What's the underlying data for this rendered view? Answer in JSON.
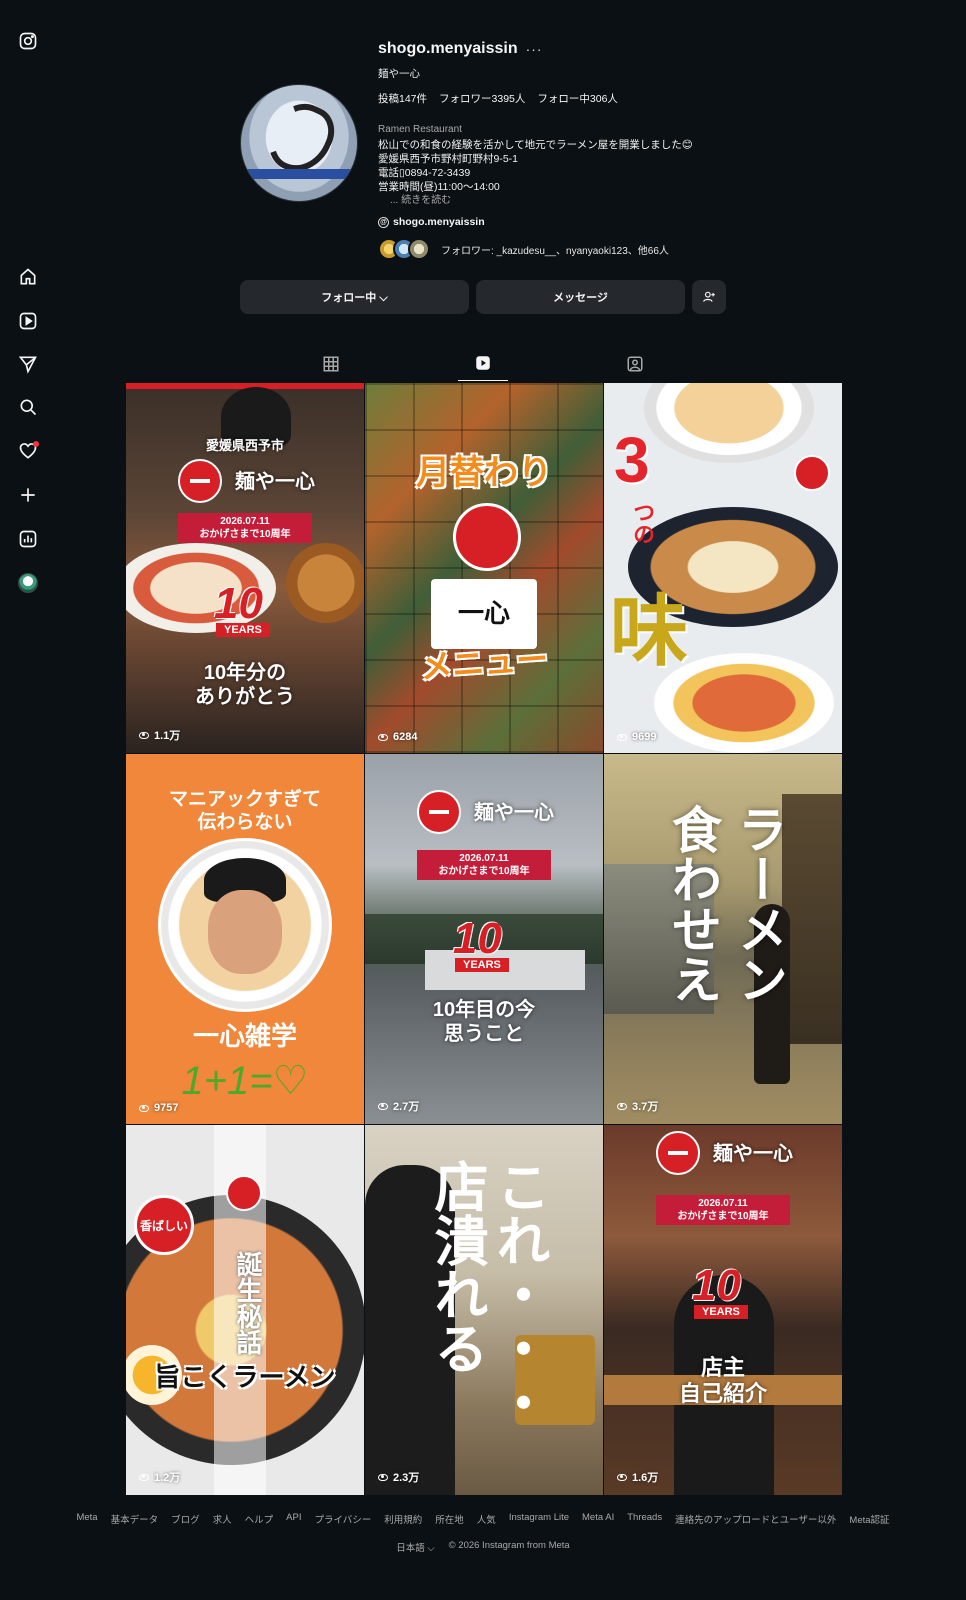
{
  "sidebar": {
    "icons": [
      "instagram-icon",
      "home-icon",
      "reels-icon",
      "direct-icon",
      "search-icon",
      "heart-icon",
      "create-icon",
      "insights-icon",
      "profile-icon"
    ]
  },
  "profile": {
    "username": "shogo.menyaissin",
    "more": "···",
    "fullname": "麺や一心",
    "stats": {
      "posts": "投稿147件",
      "followers": "フォロワー3395人",
      "following": "フォロー中306人"
    },
    "category": "Ramen Restaurant",
    "bio": [
      "松山での和食の経験を活かして地元でラーメン屋を開業しました😊",
      "愛媛県西予市野村町野村9-5-1",
      "電話▯0894-72-3439",
      "営業時間(昼)11:00〜14:00"
    ],
    "bio_more": "... 続きを読む",
    "threads_handle": "shogo.menyaissin",
    "followed_by": "フォロワー: _kazudesu__、nyanyaoki123、他66人"
  },
  "buttons": {
    "follow": "フォロー中 ⌵",
    "message": "メッセージ"
  },
  "tabs": [
    "posts-tab",
    "reels-tab",
    "tagged-tab"
  ],
  "reels": [
    {
      "views": "1.1万",
      "caption_top": "愛媛県西予市",
      "brand": "麺や一心",
      "date": "2026.07.11",
      "sub": "おかげさまで10周年",
      "ten": "10",
      "years": "YEARS",
      "caption": "10年分の\nありがとう"
    },
    {
      "views": "6284",
      "title": "月替わり",
      "caption": "メニュー"
    },
    {
      "views": "9699",
      "number": "3",
      "small": "つの",
      "big": "味"
    },
    {
      "views": "9757",
      "title": "マニアックすぎて\n伝わらない",
      "caption": "一心雑学",
      "scribble": "1+1=♡"
    },
    {
      "views": "2.7万",
      "brand": "麺や一心",
      "date": "2026.07.11",
      "sub": "おかげさまで10周年",
      "ten": "10",
      "years": "YEARS",
      "caption": "10年目の今\n思うこと"
    },
    {
      "views": "3.7万",
      "col1": "ラーメン",
      "col2": "食わせえ"
    },
    {
      "views": "1.2万",
      "vertical": "誕生秘話",
      "caption": "旨こくラーメン",
      "stamp": "香ばしい"
    },
    {
      "views": "2.3万",
      "col1": "これ・・・",
      "col2": "店潰れる"
    },
    {
      "views": "1.6万",
      "brand": "麺や一心",
      "date": "2026.07.11",
      "sub": "おかげさまで10周年",
      "ten": "10",
      "years": "YEARS",
      "caption": "店主\n自己紹介"
    }
  ],
  "footer": {
    "links": [
      "Meta",
      "基本データ",
      "ブログ",
      "求人",
      "ヘルプ",
      "API",
      "プライバシー",
      "利用規約",
      "所在地",
      "人気",
      "Instagram Lite",
      "Meta AI",
      "Threads",
      "連絡先のアップロードとユーザー以外",
      "Meta認証"
    ],
    "language": "日本語 ⌵",
    "copyright": "© 2026 Instagram from Meta"
  },
  "colors": {
    "background": "#0b1014",
    "button": "#25292e",
    "brand_red": "#d71f26",
    "notification": "#ff3040"
  }
}
